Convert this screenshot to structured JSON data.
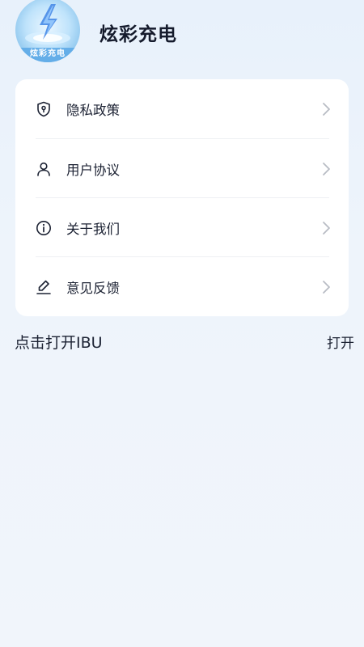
{
  "app": {
    "name": "炫彩充电",
    "logo_text": "炫彩充电"
  },
  "menu": {
    "items": [
      {
        "label": "隐私政策",
        "icon": "shield-icon"
      },
      {
        "label": "用户协议",
        "icon": "user-icon"
      },
      {
        "label": "关于我们",
        "icon": "info-icon"
      },
      {
        "label": "意见反馈",
        "icon": "edit-icon"
      }
    ]
  },
  "ibu": {
    "text": "点击打开IBU",
    "action_label": "打开"
  },
  "colors": {
    "background": "#e8f1fb",
    "card": "#ffffff",
    "text": "#1c2233",
    "chevron": "#b8bcc4"
  }
}
